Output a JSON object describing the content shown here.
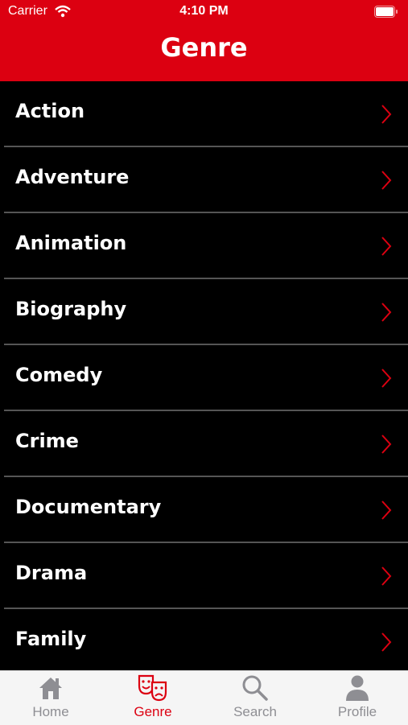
{
  "status": {
    "carrier": "Carrier",
    "time": "4:10 PM"
  },
  "header": {
    "title": "Genre"
  },
  "genres": [
    {
      "label": "Action"
    },
    {
      "label": "Adventure"
    },
    {
      "label": "Animation"
    },
    {
      "label": "Biography"
    },
    {
      "label": "Comedy"
    },
    {
      "label": "Crime"
    },
    {
      "label": "Documentary"
    },
    {
      "label": "Drama"
    },
    {
      "label": "Family"
    }
  ],
  "tabs": [
    {
      "label": "Home",
      "icon": "home-icon"
    },
    {
      "label": "Genre",
      "icon": "theater-masks-icon",
      "active": true
    },
    {
      "label": "Search",
      "icon": "search-icon"
    },
    {
      "label": "Profile",
      "icon": "profile-icon"
    }
  ],
  "colors": {
    "accent": "#dc0011",
    "background": "#000000",
    "divider": "#555555",
    "tab_inactive": "#8e8e93"
  }
}
